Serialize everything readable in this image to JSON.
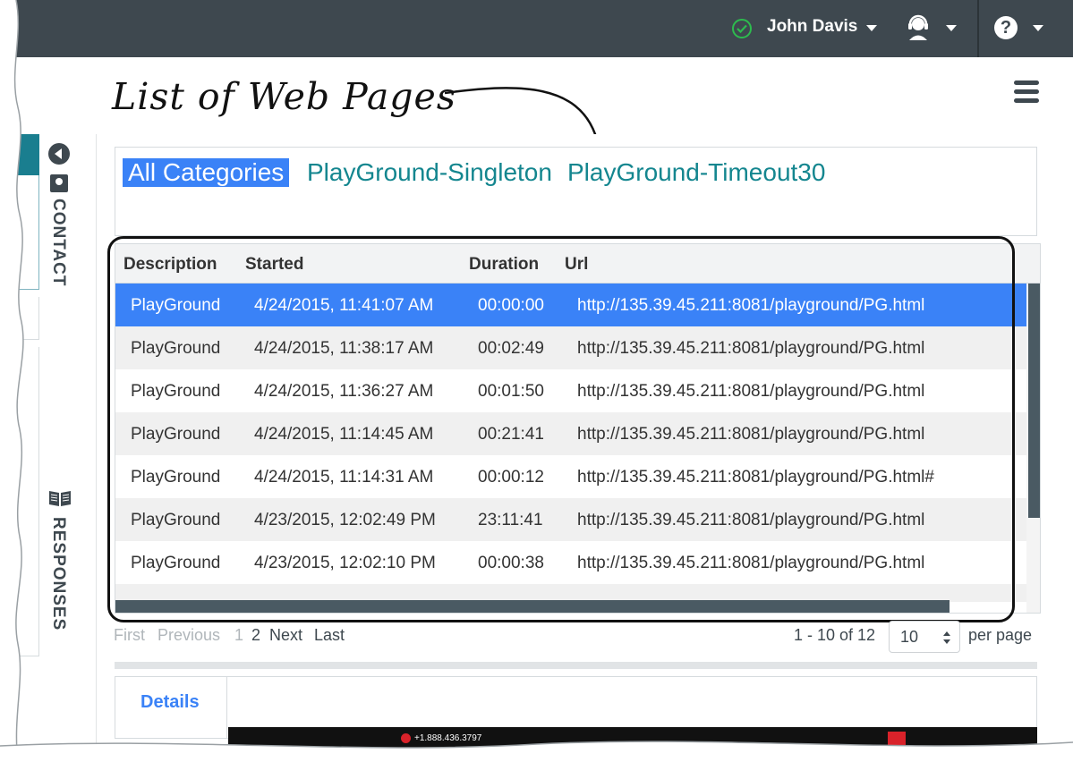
{
  "topbar": {
    "user_name": "John Davis",
    "status_icon": "check-circle-icon",
    "agent_icon": "headset-agent-icon",
    "help_icon": "question-circle-icon",
    "help_glyph": "?",
    "bg_color": "#3e484f",
    "status_color": "#2dbb4e"
  },
  "callout": {
    "text": "List of Web Pages"
  },
  "sidebar": {
    "tabs": [
      {
        "label": "CONTACT",
        "icon": "contact-card-icon"
      },
      {
        "label": "RESPONSES",
        "icon": "book-icon"
      }
    ]
  },
  "categories": {
    "items": [
      {
        "label": "All Categories",
        "active": true
      },
      {
        "label": "PlayGround-Singleton",
        "active": false
      },
      {
        "label": "PlayGround-Timeout30",
        "active": false
      }
    ],
    "active_color": "#3a82f7",
    "link_color": "#14868f"
  },
  "grid": {
    "columns": [
      "Description",
      "Started",
      "Duration",
      "Url"
    ],
    "rows": [
      {
        "description": "PlayGround",
        "started": "4/24/2015, 11:41:07 AM",
        "duration": "00:00:00",
        "url": "http://135.39.45.211:8081/playground/PG.html",
        "selected": true
      },
      {
        "description": "PlayGround",
        "started": "4/24/2015, 11:38:17 AM",
        "duration": "00:02:49",
        "url": "http://135.39.45.211:8081/playground/PG.html",
        "selected": false
      },
      {
        "description": "PlayGround",
        "started": "4/24/2015, 11:36:27 AM",
        "duration": "00:01:50",
        "url": "http://135.39.45.211:8081/playground/PG.html",
        "selected": false
      },
      {
        "description": "PlayGround",
        "started": "4/24/2015, 11:14:45 AM",
        "duration": "00:21:41",
        "url": "http://135.39.45.211:8081/playground/PG.html",
        "selected": false
      },
      {
        "description": "PlayGround",
        "started": "4/24/2015, 11:14:31 AM",
        "duration": "00:00:12",
        "url": "http://135.39.45.211:8081/playground/PG.html#",
        "selected": false
      },
      {
        "description": "PlayGround",
        "started": "4/23/2015, 12:02:49 PM",
        "duration": "23:11:41",
        "url": "http://135.39.45.211:8081/playground/PG.html",
        "selected": false
      },
      {
        "description": "PlayGround",
        "started": "4/23/2015, 12:02:10 PM",
        "duration": "00:00:38",
        "url": "http://135.39.45.211:8081/playground/PG.html",
        "selected": false
      }
    ],
    "selected_color": "#3a82f7"
  },
  "pagination": {
    "first": "First",
    "previous": "Previous",
    "page1": "1",
    "page2": "2",
    "next": "Next",
    "last": "Last",
    "range_text": "1 - 10 of 12",
    "per_page_value": "10",
    "per_page_label": "per page"
  },
  "details": {
    "tab_label": "Details",
    "phone_text": "+1.888.436.3797"
  }
}
